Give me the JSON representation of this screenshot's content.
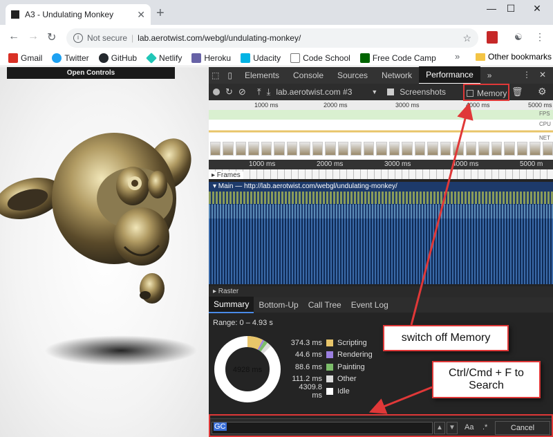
{
  "browser": {
    "tab_title": "A3 - Undulating Monkey",
    "tab_close": "✕",
    "new_tab": "+",
    "window_min": "—",
    "window_max": "☐",
    "window_close": "✕",
    "nav_back": "←",
    "nav_forward": "→",
    "nav_reload": "↻",
    "security_label": "Not secure",
    "separator": "|",
    "url": "lab.aerotwist.com/webgl/undulating-monkey/",
    "bookmarks": [
      {
        "label": "Gmail",
        "color": "#d93025"
      },
      {
        "label": "Twitter",
        "color": "#1da1f2"
      },
      {
        "label": "GitHub",
        "color": "#24292e"
      },
      {
        "label": "Netlify",
        "color": "#20c6b7"
      },
      {
        "label": "Heroku",
        "color": "#6762a6"
      },
      {
        "label": "Udacity",
        "color": "#02b3e4"
      },
      {
        "label": "Code School",
        "color": "#777777"
      },
      {
        "label": "Free Code Camp",
        "color": "#006400"
      }
    ],
    "bookmarks_more": "»",
    "other_bookmarks": "Other bookmarks"
  },
  "page": {
    "open_controls": "Open Controls"
  },
  "devtools": {
    "tabs": [
      "Elements",
      "Console",
      "Sources",
      "Network",
      "Performance"
    ],
    "active_tab": "Performance",
    "more_tabs": "»",
    "menu": "⋮",
    "close": "✕",
    "recording_target": "lab.aerotwist.com #3",
    "screenshots_label": "Screenshots",
    "memory_label": "Memory",
    "overview_ticks": [
      "1000 ms",
      "2000 ms",
      "3000 ms",
      "4000 ms",
      "5000 ms"
    ],
    "overview_labels": {
      "fps": "FPS",
      "cpu": "CPU",
      "net": "NET"
    },
    "timeline_ticks": [
      "1000 ms",
      "2000 ms",
      "3000 ms",
      "4000 ms",
      "5000 m"
    ],
    "frames_label": "▸ Frames",
    "main_label": "▾ Main — http://lab.aerotwist.com/webgl/undulating-monkey/",
    "raster_label": "▸ Raster",
    "summary_tabs": [
      "Summary",
      "Bottom-Up",
      "Call Tree",
      "Event Log"
    ],
    "range_text": "Range: 0 – 4.93 s",
    "donut_total": "4928 ms",
    "legend": [
      {
        "value": "374.3 ms",
        "name": "Scripting",
        "color": "#e8c56a"
      },
      {
        "value": "44.6 ms",
        "name": "Rendering",
        "color": "#9b7fe0"
      },
      {
        "value": "88.6 ms",
        "name": "Painting",
        "color": "#7cbd6a"
      },
      {
        "value": "111.2 ms",
        "name": "Other",
        "color": "#dcdcdc"
      },
      {
        "value": "4309.8 ms",
        "name": "Idle",
        "color": "#ffffff"
      }
    ],
    "search_value": "GC",
    "search_prev": "▲",
    "search_next": "▼",
    "match_case": "Aa",
    "regex": ".*",
    "cancel": "Cancel"
  },
  "annotations": {
    "memory_callout": "switch off Memory",
    "search_callout": "Ctrl/Cmd + F to Search",
    "accent": "#e03838"
  }
}
